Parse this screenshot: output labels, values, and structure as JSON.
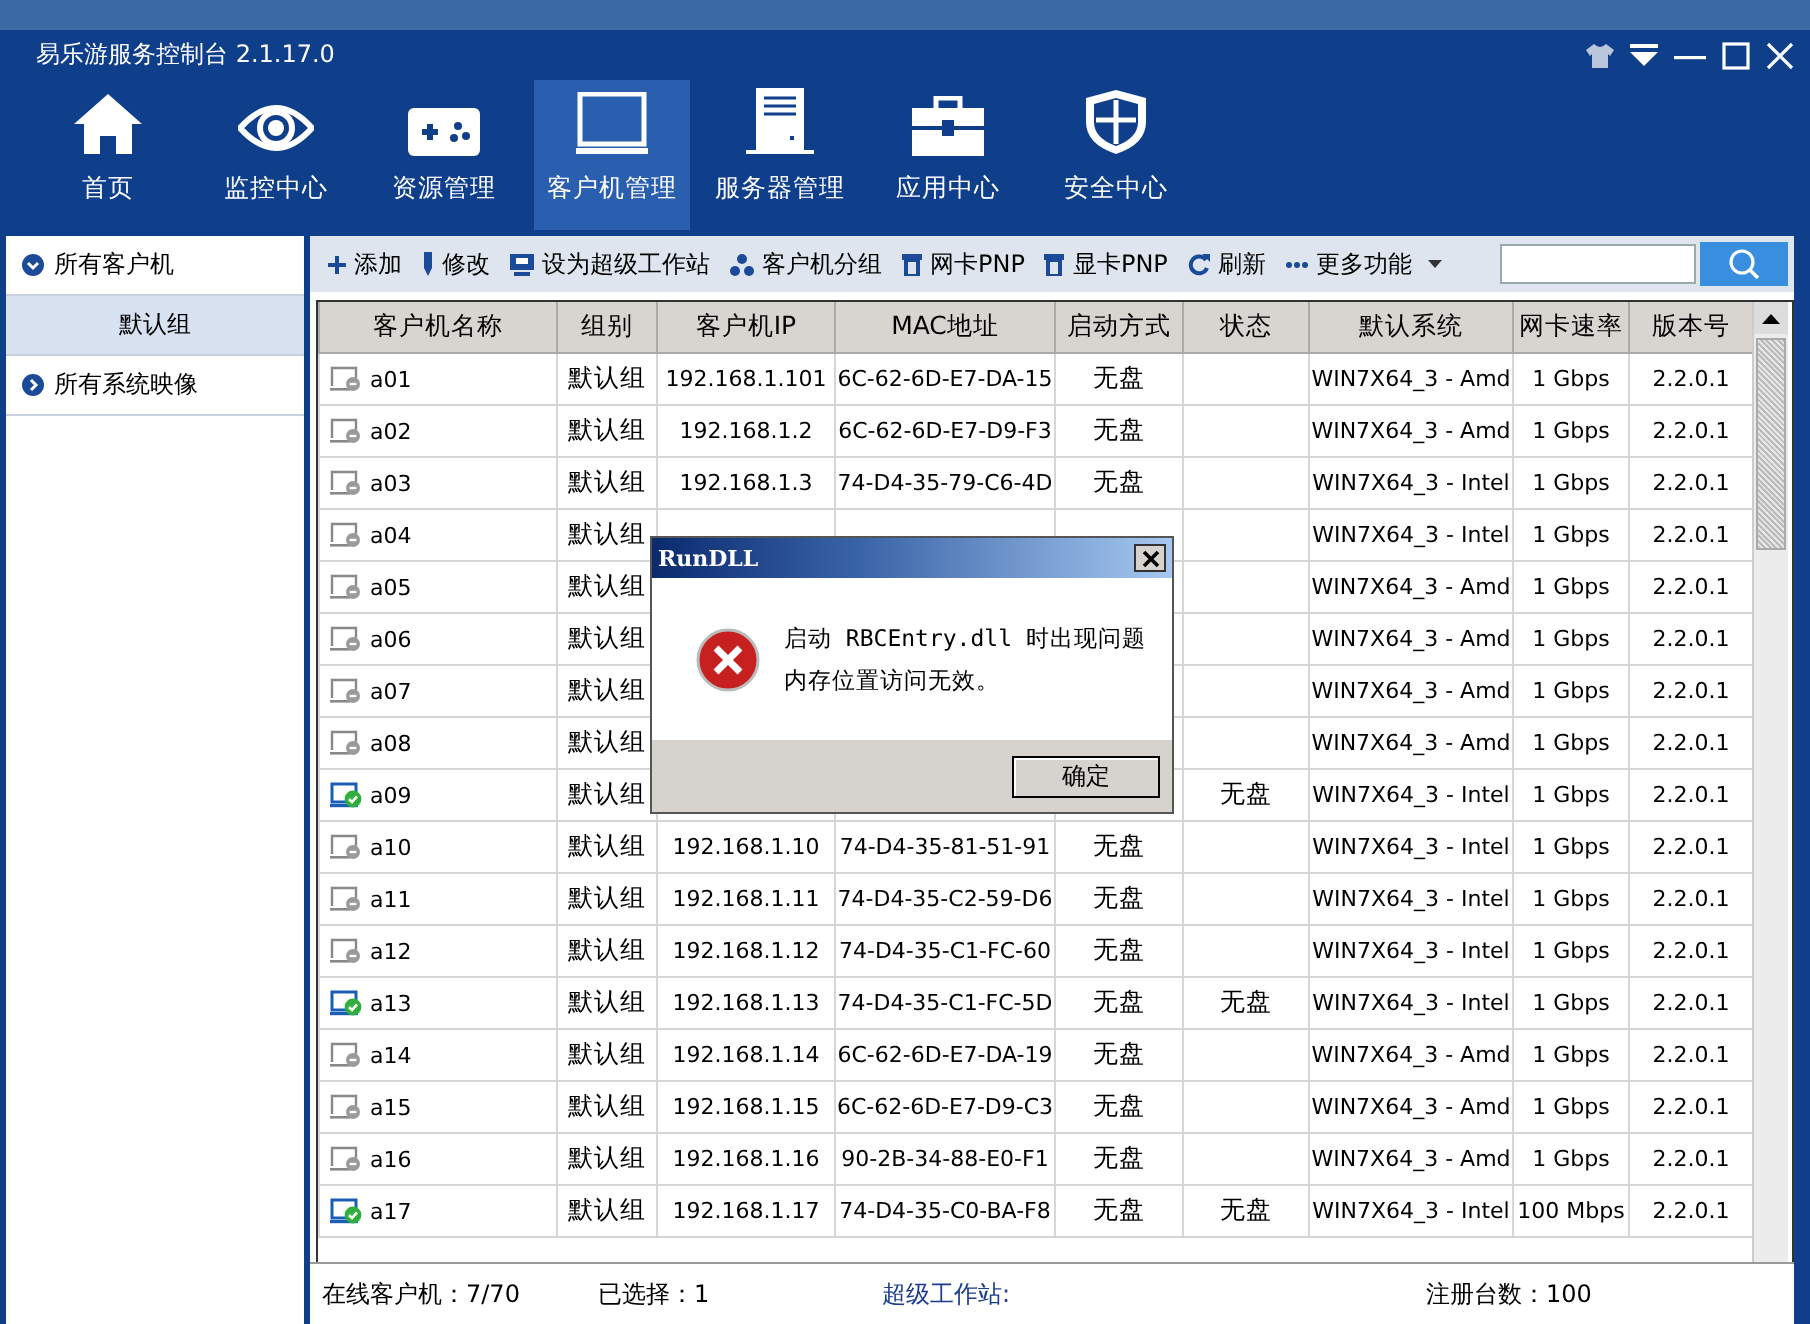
{
  "window": {
    "title": "易乐游服务控制台 2.1.17.0"
  },
  "nav": [
    {
      "label": "首页",
      "selected": false
    },
    {
      "label": "监控中心",
      "selected": false
    },
    {
      "label": "资源管理",
      "selected": false
    },
    {
      "label": "客户机管理",
      "selected": true
    },
    {
      "label": "服务器管理",
      "selected": false
    },
    {
      "label": "应用中心",
      "selected": false
    },
    {
      "label": "安全中心",
      "selected": false
    }
  ],
  "sidebar": {
    "items": [
      {
        "label": "所有客户机",
        "expanded": true,
        "selected": false,
        "children": [
          {
            "label": "默认组",
            "selected": true
          }
        ]
      },
      {
        "label": "所有系统映像",
        "expanded": false,
        "selected": false
      }
    ]
  },
  "toolbar": [
    "添加",
    "修改",
    "设为超级工作站",
    "客户机分组",
    "网卡PNP",
    "显卡PNP",
    "刷新",
    "更多功能"
  ],
  "table": {
    "columns": [
      "客户机名称",
      "组别",
      "客户机IP",
      "MAC地址",
      "启动方式",
      "状态",
      "默认系统",
      "网卡速率",
      "版本号"
    ],
    "rows": [
      {
        "name": "a01",
        "online": false,
        "group": "默认组",
        "ip": "192.168.1.101",
        "mac": "6C-62-6D-E7-DA-15",
        "boot": "无盘",
        "system": "WIN7X64_3 - Amd",
        "speed": "1 Gbps",
        "version": "2.2.0.1"
      },
      {
        "name": "a02",
        "online": false,
        "group": "默认组",
        "ip": "192.168.1.2",
        "mac": "6C-62-6D-E7-D9-F3",
        "boot": "无盘",
        "system": "WIN7X64_3 - Amd",
        "speed": "1 Gbps",
        "version": "2.2.0.1"
      },
      {
        "name": "a03",
        "online": false,
        "group": "默认组",
        "ip": "192.168.1.3",
        "mac": "74-D4-35-79-C6-4D",
        "boot": "无盘",
        "system": "WIN7X64_3 - Intel",
        "speed": "1 Gbps",
        "version": "2.2.0.1"
      },
      {
        "name": "a04",
        "online": false,
        "group": "默认组",
        "system": "WIN7X64_3 - Intel",
        "speed": "1 Gbps",
        "version": "2.2.0.1"
      },
      {
        "name": "a05",
        "online": false,
        "group": "默认组",
        "system": "WIN7X64_3 - Amd",
        "speed": "1 Gbps",
        "version": "2.2.0.1"
      },
      {
        "name": "a06",
        "online": false,
        "group": "默认组",
        "system": "WIN7X64_3 - Amd",
        "speed": "1 Gbps",
        "version": "2.2.0.1"
      },
      {
        "name": "a07",
        "online": false,
        "group": "默认组",
        "system": "WIN7X64_3 - Amd",
        "speed": "1 Gbps",
        "version": "2.2.0.1"
      },
      {
        "name": "a08",
        "online": false,
        "group": "默认组",
        "system": "WIN7X64_3 - Amd",
        "speed": "1 Gbps",
        "version": "2.2.0.1"
      },
      {
        "name": "a09",
        "online": true,
        "group": "默认组",
        "status": "无盘",
        "system": "WIN7X64_3 - Intel",
        "speed": "1 Gbps",
        "version": "2.2.0.1"
      },
      {
        "name": "a10",
        "online": false,
        "group": "默认组",
        "ip": "192.168.1.10",
        "mac": "74-D4-35-81-51-91",
        "boot": "无盘",
        "system": "WIN7X64_3 - Intel",
        "speed": "1 Gbps",
        "version": "2.2.0.1"
      },
      {
        "name": "a11",
        "online": false,
        "group": "默认组",
        "ip": "192.168.1.11",
        "mac": "74-D4-35-C2-59-D6",
        "boot": "无盘",
        "system": "WIN7X64_3 - Intel",
        "speed": "1 Gbps",
        "version": "2.2.0.1"
      },
      {
        "name": "a12",
        "online": false,
        "group": "默认组",
        "ip": "192.168.1.12",
        "mac": "74-D4-35-C1-FC-60",
        "boot": "无盘",
        "system": "WIN7X64_3 - Intel",
        "speed": "1 Gbps",
        "version": "2.2.0.1"
      },
      {
        "name": "a13",
        "online": true,
        "group": "默认组",
        "ip": "192.168.1.13",
        "mac": "74-D4-35-C1-FC-5D",
        "boot": "无盘",
        "status": "无盘",
        "system": "WIN7X64_3 - Intel",
        "speed": "1 Gbps",
        "version": "2.2.0.1"
      },
      {
        "name": "a14",
        "online": false,
        "group": "默认组",
        "ip": "192.168.1.14",
        "mac": "6C-62-6D-E7-DA-19",
        "boot": "无盘",
        "system": "WIN7X64_3 - Amd",
        "speed": "1 Gbps",
        "version": "2.2.0.1"
      },
      {
        "name": "a15",
        "online": false,
        "group": "默认组",
        "ip": "192.168.1.15",
        "mac": "6C-62-6D-E7-D9-C3",
        "boot": "无盘",
        "system": "WIN7X64_3 - Amd",
        "speed": "1 Gbps",
        "version": "2.2.0.1"
      },
      {
        "name": "a16",
        "online": false,
        "group": "默认组",
        "ip": "192.168.1.16",
        "mac": "90-2B-34-88-E0-F1",
        "boot": "无盘",
        "system": "WIN7X64_3 - Amd",
        "speed": "1 Gbps",
        "version": "2.2.0.1"
      },
      {
        "name": "a17",
        "online": true,
        "group": "默认组",
        "ip": "192.168.1.17",
        "mac": "74-D4-35-C0-BA-F8",
        "boot": "无盘",
        "status": "无盘",
        "system": "WIN7X64_3 - Intel",
        "speed": "100 Mbps",
        "version": "2.2.0.1"
      }
    ]
  },
  "status_bar": [
    {
      "kind": "label",
      "text": "在线客户机：7/70"
    },
    {
      "kind": "label",
      "text": "已选择：1"
    },
    {
      "kind": "link",
      "text": "超级工作站:"
    },
    {
      "kind": "label",
      "text": "注册台数：100"
    }
  ],
  "dialog": {
    "title": "RunDLL",
    "lines": [
      "启动 RBCEntry.dll 时出现问题",
      "内存位置访问无效。"
    ],
    "button": "确定"
  }
}
